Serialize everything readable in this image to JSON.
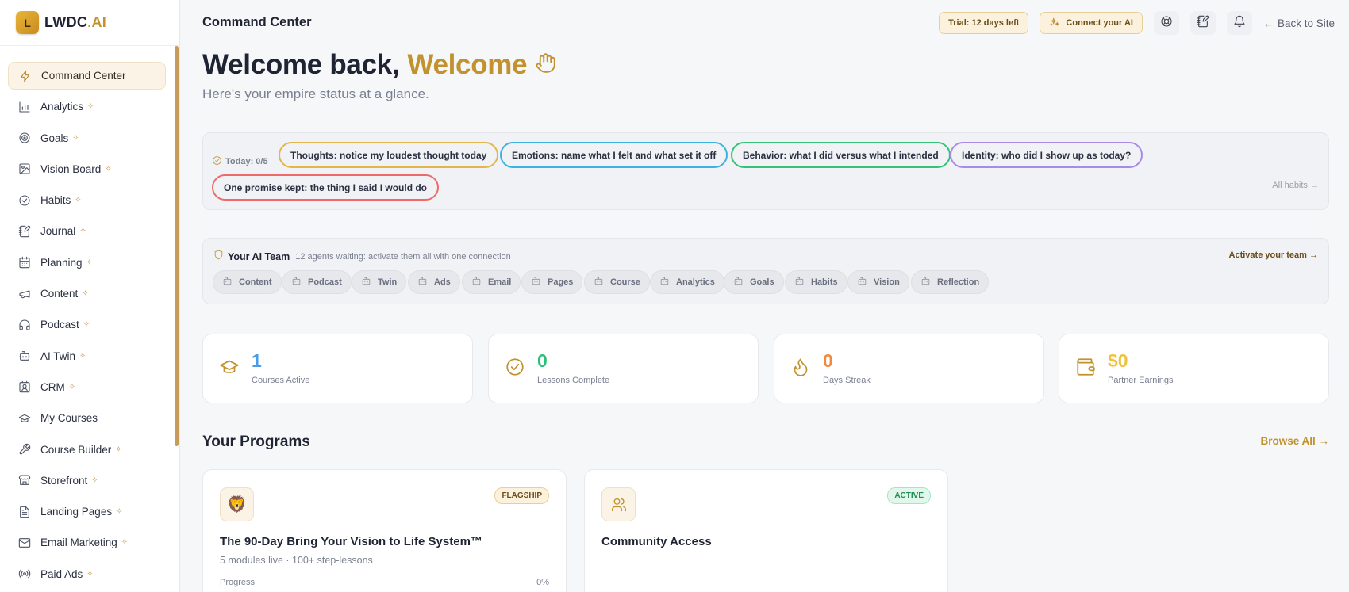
{
  "brand": {
    "logo_letter": "L",
    "name_main": "LWDC",
    "name_accent": ".AI"
  },
  "sidebar": {
    "items": [
      {
        "label": "Command Center",
        "icon": "bolt-icon",
        "spark": false,
        "active": true
      },
      {
        "label": "Analytics",
        "icon": "bar-chart-icon",
        "spark": true
      },
      {
        "label": "Goals",
        "icon": "target-icon",
        "spark": true
      },
      {
        "label": "Vision Board",
        "icon": "image-icon",
        "spark": true
      },
      {
        "label": "Habits",
        "icon": "check-circle-icon",
        "spark": true
      },
      {
        "label": "Journal",
        "icon": "notebook-pen-icon",
        "spark": true
      },
      {
        "label": "Planning",
        "icon": "calendar-icon",
        "spark": true
      },
      {
        "label": "Content",
        "icon": "megaphone-icon",
        "spark": true
      },
      {
        "label": "Podcast",
        "icon": "headphones-icon",
        "spark": true
      },
      {
        "label": "AI Twin",
        "icon": "bot-icon",
        "spark": true
      },
      {
        "label": "CRM",
        "icon": "contact-icon",
        "spark": true
      },
      {
        "label": "My Courses",
        "icon": "graduation-cap-icon",
        "spark": false
      },
      {
        "label": "Course Builder",
        "icon": "wrench-icon",
        "spark": true
      },
      {
        "label": "Storefront",
        "icon": "store-icon",
        "spark": true
      },
      {
        "label": "Landing Pages",
        "icon": "file-text-icon",
        "spark": true
      },
      {
        "label": "Email Marketing",
        "icon": "mail-icon",
        "spark": true
      },
      {
        "label": "Paid Ads",
        "icon": "radio-icon",
        "spark": true
      }
    ],
    "spark_glyph": "✧"
  },
  "topbar": {
    "title": "Command Center",
    "trial": "Trial: 12 days left",
    "connect": "Connect your AI",
    "back": "Back to Site",
    "back_arrow": "←"
  },
  "welcome": {
    "prefix": "Welcome back,",
    "name": "Welcome",
    "subtitle": "Here's your empire status at a glance."
  },
  "habits": {
    "today": "Today: 0/5",
    "all_link": "All habits →",
    "pills": [
      {
        "label": "Thoughts: notice my loudest thought today",
        "color": "#e2b64c"
      },
      {
        "label": "Emotions: name what I felt and what set it off",
        "color": "#3bb3e0"
      },
      {
        "label": "Behavior: what I did versus what I intended",
        "color": "#34c27a"
      },
      {
        "label": "Identity: who did I show up as today?",
        "color": "#a98ae6"
      },
      {
        "label": "One promise kept: the thing I said I would do",
        "color": "#ee6a6a"
      }
    ]
  },
  "team": {
    "title": "Your AI Team",
    "subtitle": "12 agents waiting: activate them all with one connection",
    "activate": "Activate your team →",
    "agents": [
      "Content",
      "Podcast",
      "Twin",
      "Ads",
      "Email",
      "Pages",
      "Course",
      "Analytics",
      "Goals",
      "Habits",
      "Vision",
      "Reflection"
    ]
  },
  "stats": [
    {
      "value": "1",
      "label": "Courses Active",
      "color": "#4a9be8",
      "icon": "graduation-cap-icon"
    },
    {
      "value": "0",
      "label": "Lessons Complete",
      "color": "#2cc07a",
      "icon": "check-circle-icon"
    },
    {
      "value": "0",
      "label": "Days Streak",
      "color": "#f08a3c",
      "icon": "flame-icon"
    },
    {
      "value": "$0",
      "label": "Partner Earnings",
      "color": "#f0c23c",
      "icon": "wallet-icon"
    }
  ],
  "programs": {
    "title": "Your Programs",
    "browse": "Browse All →",
    "items": [
      {
        "icon": "lion-icon",
        "emoji": "🦁",
        "badge": "FLAGSHIP",
        "title": "The 90-Day Bring Your Vision to Life System™",
        "subtitle": "5 modules live · 100+ step-lessons",
        "progress_label": "Progress",
        "progress_value": "0%",
        "progress": 0
      },
      {
        "icon": "users-icon",
        "badge": "ACTIVE",
        "title": "Community Access"
      }
    ]
  }
}
